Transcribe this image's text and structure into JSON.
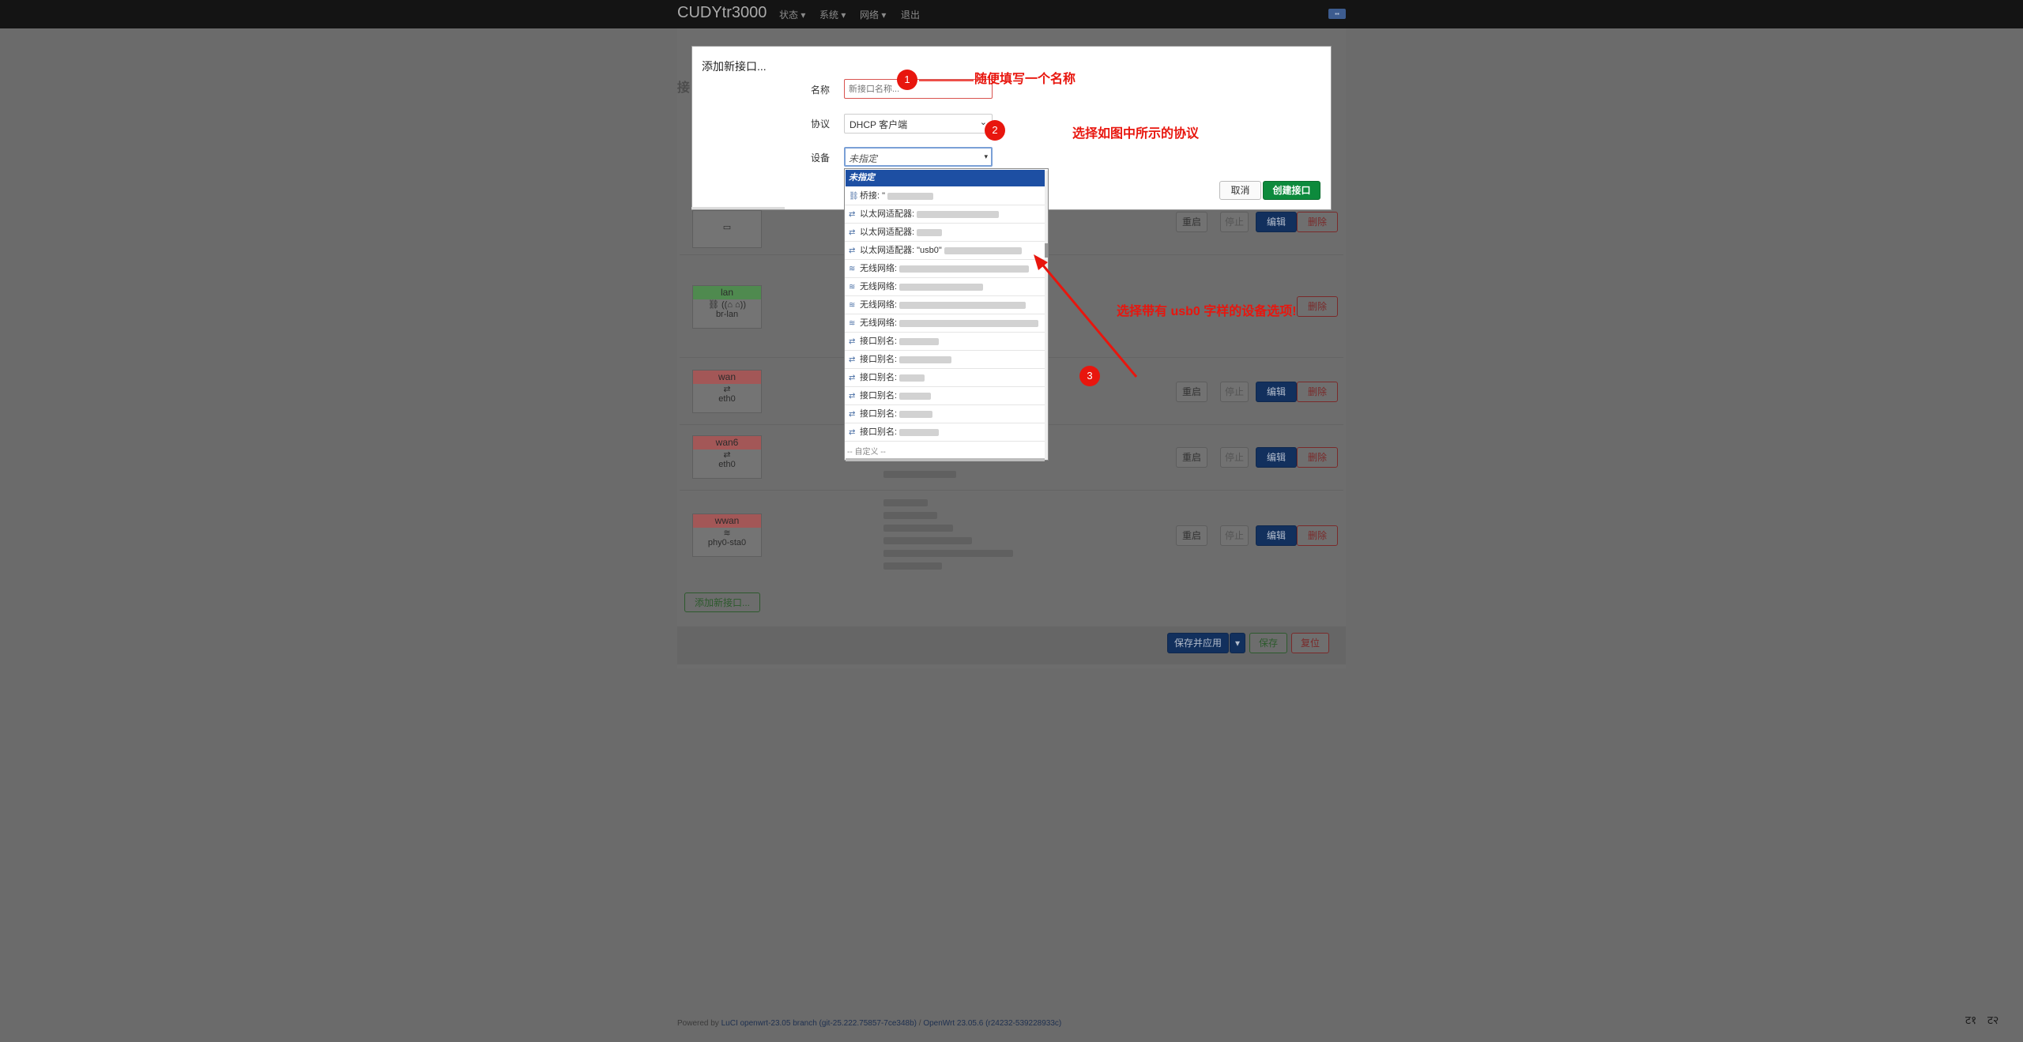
{
  "navbar": {
    "brand": "CUDYtr3000",
    "items": [
      "状态 ▾",
      "系统 ▾",
      "网络 ▾",
      "退出"
    ]
  },
  "background": {
    "title_initial": "接",
    "interfaces": [
      {
        "name": "lan",
        "device": "br-lan"
      },
      {
        "name": "wan",
        "device": "eth0"
      },
      {
        "name": "wan6",
        "device": "eth0"
      },
      {
        "name": "wwan",
        "device": "phy0-sta0"
      }
    ],
    "row_buttons": {
      "restart": "重启",
      "stop": "停止",
      "edit": "编辑",
      "delete": "删除"
    },
    "add_interface": "添加新接口...",
    "save_apply": "保存并应用",
    "save": "保存",
    "reset": "复位"
  },
  "modal": {
    "title": "添加新接口...",
    "name_label": "名称",
    "name_placeholder": "新接口名称...",
    "protocol_label": "协议",
    "protocol_value": "DHCP 客户端",
    "device_label": "设备",
    "device_value": "未指定",
    "cancel": "取消",
    "create": "创建接口"
  },
  "dropdown": {
    "selected": "未指定",
    "items": [
      {
        "icon": "bridge-icon",
        "label": "桥接: \""
      },
      {
        "icon": "ethernet-icon",
        "label": "以太网适配器:"
      },
      {
        "icon": "ethernet-icon",
        "label": "以太网适配器:"
      },
      {
        "icon": "ethernet-icon",
        "label": "以太网适配器: \"usb0\""
      },
      {
        "icon": "wifi-icon",
        "label": "无线网络:"
      },
      {
        "icon": "wifi-icon",
        "label": "无线网络:"
      },
      {
        "icon": "wifi-icon",
        "label": "无线网络:"
      },
      {
        "icon": "wifi-icon",
        "label": "无线网络:"
      },
      {
        "icon": "alias-icon",
        "label": "接口别名:"
      },
      {
        "icon": "alias-icon",
        "label": "接口别名:"
      },
      {
        "icon": "alias-icon",
        "label": "接口别名:"
      },
      {
        "icon": "alias-icon",
        "label": "接口别名:"
      },
      {
        "icon": "alias-icon",
        "label": "接口别名:"
      },
      {
        "icon": "alias-icon",
        "label": "接口别名:"
      }
    ],
    "custom": "-- 自定义 --"
  },
  "annotations": {
    "step1": "随便填写一个名称",
    "step2": "选择如图中所示的协议",
    "step3": "选择带有 usb0 字样的设备选项!",
    "badges": [
      "1",
      "2",
      "3"
    ]
  },
  "footer": {
    "prefix": "Powered by ",
    "luci": "LuCI openwrt-23.05 branch (git-25.222.75857-7ce348b)",
    "sep": " / ",
    "openwrt": "OpenWrt 23.05.6 (r24232-539228933c)"
  },
  "corner_glyphs": [
    "ट१",
    "ट२"
  ],
  "colors": {
    "accent_red": "#e8160e",
    "create_green": "#0d8a3c",
    "selected_blue": "#1d4fa3"
  }
}
